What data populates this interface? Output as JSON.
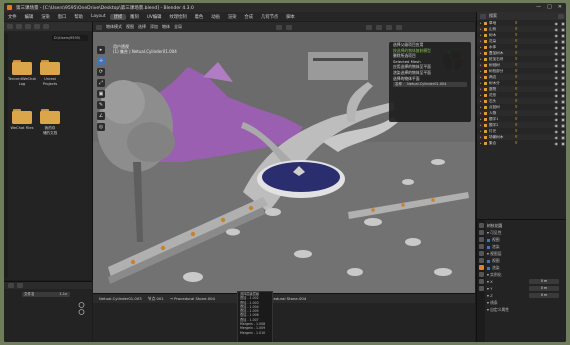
{
  "window": {
    "title": "第三课场景 - [C:\\Users\\9595\\OneDrive\\Desktop\\第三课场景.blend] - Blender 4.3.0",
    "min": "—",
    "max": "□",
    "close": "✕"
  },
  "menubar": {
    "items": [
      "文件",
      "编辑",
      "渲染",
      "窗口",
      "帮助",
      "Layout",
      "建模",
      "雕刻",
      "UV编辑",
      "纹理绘制",
      "着色",
      "动画",
      "渲染",
      "合成",
      "几何节点",
      "脚本"
    ],
    "active_index": 6,
    "scene": "Scene",
    "view_layer": "ViewLayer"
  },
  "file_browser": {
    "path": "D:\\Users\\9595\\",
    "folders": [
      {
        "label": "TencentWeChat\nLog"
      },
      {
        "label": "Unreal\nProjects"
      },
      {
        "label": "WeChat Files"
      },
      {
        "label": "我的存\n储的文档"
      }
    ]
  },
  "bottom_left": {
    "field_label": "文件名",
    "field_value": "1.1x"
  },
  "viewport": {
    "header_items": [
      "物体模式",
      "视图",
      "选择",
      "添加",
      "物体",
      "全局"
    ],
    "info_line1": "用户透视",
    "info_line2": "(1) 集合 | Netual.Cylinder01.004",
    "tools": [
      "▸",
      "✛",
      "⟳",
      "⤢",
      "▣",
      "✎",
      "∠",
      "◎"
    ]
  },
  "context_popup": {
    "items": [
      {
        "text": "选择父级项目应用",
        "highlight": false
      },
      {
        "text": "按选择的物体复制模型",
        "highlight": true
      },
      {
        "text": "删除所选项目",
        "highlight": false
      },
      {
        "text": "Selected Mesh",
        "highlight": false
      },
      {
        "text": "应用选择的物体至平面",
        "highlight": false
      },
      {
        "text": "渲染选择的物体至平面",
        "highlight": false
      },
      {
        "text": "选择的物体平面",
        "highlight": false
      }
    ],
    "field_label": "名称",
    "field_value": "Netual.Cylinder01.004"
  },
  "timeline": {
    "items": [
      "Netual.Cylinder01.003",
      "节点.001",
      "→ Procedural Stone.004",
      "→ Procedural Stone.004"
    ]
  },
  "dropdown": {
    "items": [
      "选择层级层级",
      "叠加 - 1.002",
      "叠加 - 1.003",
      "叠加 - 1.004",
      "叠加 - 1.005",
      "叠加 - 1.006",
      "叠加 - 1.007",
      "Mergeln - 1.008",
      "Mergeln - 1.009",
      "Mergeln - 1.010"
    ]
  },
  "outliner": {
    "search": "搜索",
    "rows": [
      {
        "name": "草地",
        "frames": "∇"
      },
      {
        "name": "山系",
        "frames": "∇"
      },
      {
        "name": "树木",
        "frames": "∇"
      },
      {
        "name": "花朵",
        "frames": "∇"
      },
      {
        "name": "水体",
        "frames": "∇"
      },
      {
        "name": "叠加树木",
        "frames": "∇"
      },
      {
        "name": "桩加石块",
        "frames": "∇"
      },
      {
        "name": "树冠树",
        "frames": "∇"
      },
      {
        "name": "树枝部分",
        "frames": "∇"
      },
      {
        "name": "两边",
        "frames": "∇"
      },
      {
        "name": "树木分",
        "frames": "∇"
      },
      {
        "name": "庭院",
        "frames": "∇"
      },
      {
        "name": "花形",
        "frames": "∇"
      },
      {
        "name": "石头",
        "frames": "∇"
      },
      {
        "name": "点贴树",
        "frames": "∇"
      },
      {
        "name": "人物",
        "frames": "∇"
      },
      {
        "name": "题字1",
        "frames": "∇"
      },
      {
        "name": "题字2",
        "frames": "∇"
      },
      {
        "name": "灯光",
        "frames": "∇"
      },
      {
        "name": "场景树木",
        "frames": "∇"
      },
      {
        "name": "集合",
        "frames": "∇"
      }
    ]
  },
  "properties": {
    "object_name": "树枝花圆",
    "rows": [
      {
        "label": "可见性",
        "value": ""
      },
      {
        "label": "视图",
        "value": "",
        "check": true
      },
      {
        "label": "渲染",
        "value": "",
        "check": true
      },
      {
        "label": "视图层",
        "value": ""
      },
      {
        "label": "视图",
        "value": "",
        "check": true
      },
      {
        "label": "渲染",
        "value": "",
        "check": true
      },
      {
        "label": "实例化",
        "value": ""
      },
      {
        "label": "X",
        "value": "0 m"
      },
      {
        "label": "Y",
        "value": "0 m"
      },
      {
        "label": "Z",
        "value": "0 m"
      },
      {
        "label": "线条",
        "value": ""
      },
      {
        "label": "自定义属性",
        "value": ""
      }
    ]
  },
  "colors": {
    "accent": "#4772b3",
    "blender_orange": "#e87d0d",
    "terrain_purple": "#9a5fb0",
    "pond_blue": "#2b2e6e",
    "highlight_green": "#7fbf5a"
  }
}
